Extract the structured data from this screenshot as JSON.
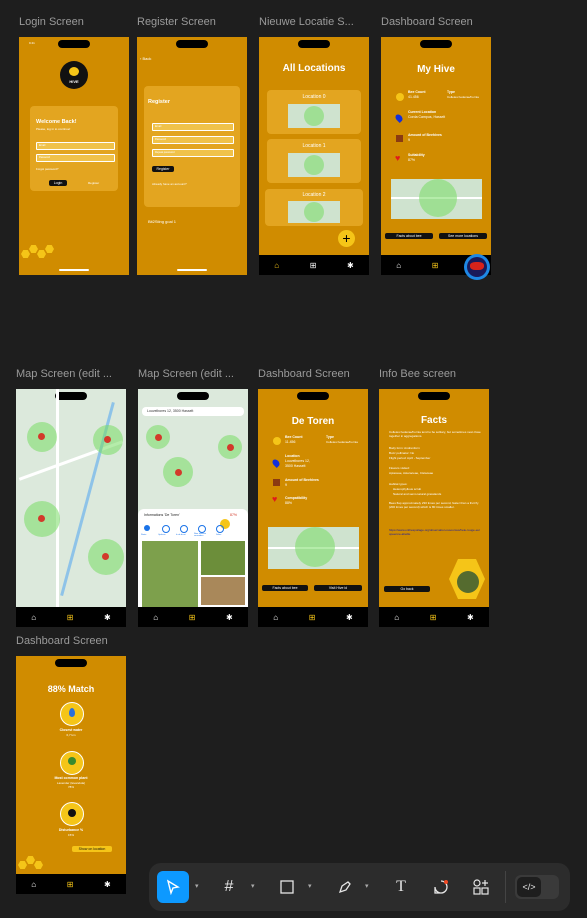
{
  "frames": {
    "f1": {
      "label": "Login Screen"
    },
    "f2": {
      "label": "Register Screen"
    },
    "f3": {
      "label": "Nieuwe Locatie S..."
    },
    "f4": {
      "label": "Dashboard Screen"
    },
    "f5": {
      "label": "Map Screen (edit ..."
    },
    "f6": {
      "label": "Map Screen (edit ..."
    },
    "f7": {
      "label": "Dashboard Screen"
    },
    "f8": {
      "label": "Info Bee screen"
    },
    "f9": {
      "label": "Dashboard Screen"
    }
  },
  "login": {
    "time": "9:41",
    "logo": "HIVE",
    "welcome": "Welcome Back!",
    "subtitle": "Please, log in to continue!",
    "email_placeholder": "Email",
    "password_placeholder": "Password",
    "forgot": "Forgot password?",
    "login_button": "Login",
    "register_link": "Register"
  },
  "register": {
    "back": "Back",
    "title": "Register",
    "email_placeholder": "Email",
    "password_placeholder": "Password",
    "repeat_placeholder": "Repeat password",
    "register_button": "Register",
    "have_account": "Already have an account?",
    "footer": "Bit2Sting goal 1"
  },
  "locations": {
    "title": "All Locations",
    "items": [
      "Location 0",
      "Location 1",
      "Location 2"
    ]
  },
  "hive": {
    "title": "My Hive",
    "bee_count_label": "Bee Count",
    "bee_count_value": "41.456",
    "type_label": "Type",
    "type_value": "Colletes hederae/hornia",
    "location_label": "Current Location",
    "location_value": "Corda Campus, Hasselt",
    "amount_label": "Amount of Beehives",
    "amount_value": "9",
    "suitability_label": "Suitability",
    "suitability_value": "87%",
    "facts_button": "Facts about bee",
    "see_more_button": "See more locations"
  },
  "mapedit2": {
    "search_value": "Louvelbores 12, 3500 Hasselt",
    "sheet_title": "Informations 'De Toren'",
    "match": "87%",
    "tabs": [
      "Route",
      "Opslaan",
      "In de buurt",
      "Naar telefoon verzenden",
      "Delen"
    ]
  },
  "toren": {
    "title": "De Toren",
    "bee_count_label": "Bee Count",
    "bee_count_value": "11.456",
    "type_label": "Type",
    "type_value": "Colletes hederae/hornia",
    "location_label": "Location",
    "location_value": "Louvelbores 12, 3500 Hasselt",
    "amount_label": "Amount of Beehives",
    "amount_value": "9",
    "compat_label": "Compatibility",
    "compat_value": "88%",
    "facts_button": "Facts about bee",
    "visit_button": "Visit Hive id"
  },
  "facts": {
    "title": "Facts",
    "intro": "Colletes hederae/hornia tend to be solitary, but sometimes nest close together in aggregations.",
    "body_line": "Body form: Andrenform",
    "buzz_line": "Buzz pollinator: No",
    "flight_line": "Flight period: April - September",
    "flowers_label": "Flowers visited:",
    "flowers_value": "Apiaceae, Asteraceae, Cistaceae",
    "habitat_label": "Habitat types:",
    "habitat_1": "Heterophyllous scrub",
    "habitat_2": "Natural and semi-natural grasslands",
    "flap_text": "Bees flap approximately 230 times per second, faster than a fruit fly (200 times per second) which is 80 times smaller.",
    "link": "https://www.onthespoilage.org/observation-resources/hele-rouge-europeenne-abeille",
    "back_button": "Go back"
  },
  "match": {
    "title": "88% Match",
    "water_label": "Closest water",
    "water_value": "0,7 km",
    "plant_label": "Most common plant",
    "plant_value": "Lavender (lavandula)",
    "plant_pct": "78%",
    "disturb_label": "Disturbance %",
    "disturb_value": "15%",
    "button": "Show on location"
  },
  "toolbar": {
    "code_label": "</>"
  },
  "colors": {
    "canvas": "#1e1e1e",
    "frame_bg": "#d08c00",
    "accent": "#f5c518",
    "toolbar_active": "#0d99ff"
  }
}
